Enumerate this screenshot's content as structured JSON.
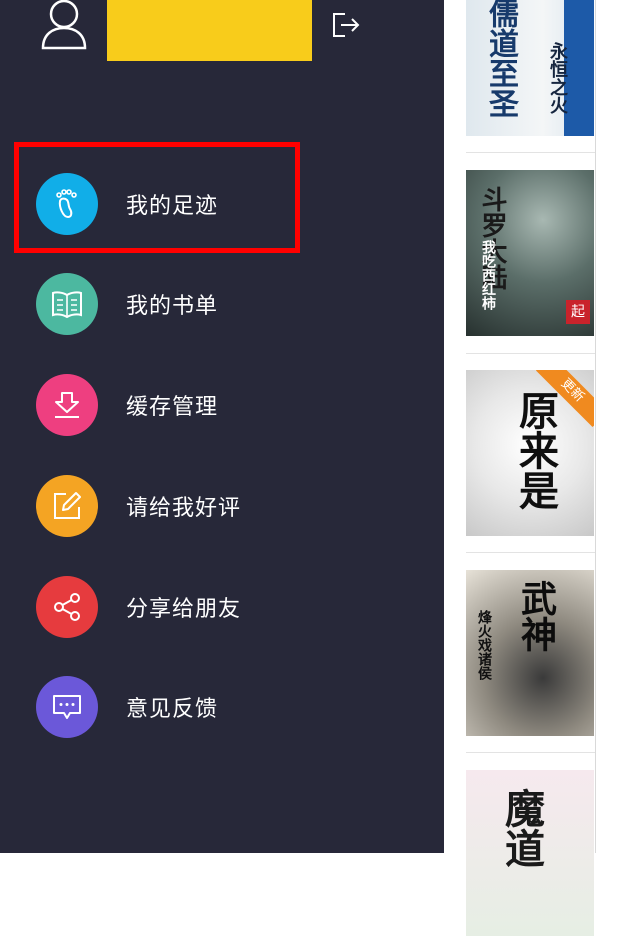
{
  "drawer": {
    "menu": [
      {
        "label": "我的足迹",
        "icon": "footprint-icon",
        "color": "#11aee8"
      },
      {
        "label": "我的书单",
        "icon": "book-list-icon",
        "color": "#4cb8a0"
      },
      {
        "label": "缓存管理",
        "icon": "download-icon",
        "color": "#ee3f80"
      },
      {
        "label": "请给我好评",
        "icon": "edit-icon",
        "color": "#f4a423"
      },
      {
        "label": "分享给朋友",
        "icon": "share-icon",
        "color": "#e63b3e"
      },
      {
        "label": "意见反馈",
        "icon": "feedback-icon",
        "color": "#6b58d9"
      }
    ]
  },
  "books": [
    {
      "title": "儒道至圣",
      "sub": "永恒之火"
    },
    {
      "title": "斗罗大陆",
      "sub": "我吃西红柿"
    },
    {
      "title": "原来是",
      "badge": "更新"
    },
    {
      "title": "武神",
      "sub": "烽火戏诸侯"
    },
    {
      "title": "魔道"
    }
  ],
  "colors": {
    "drawer_bg": "#272839",
    "accent_yellow": "#f8cc1b",
    "highlight": "#ff0000"
  }
}
